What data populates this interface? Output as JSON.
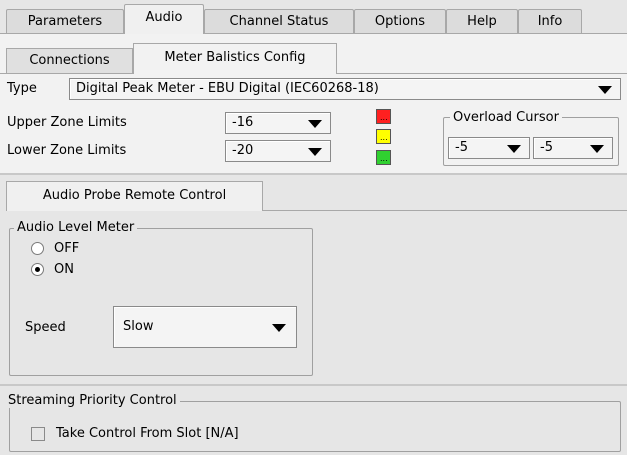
{
  "tabs": [
    {
      "label": "Parameters"
    },
    {
      "label": "Audio"
    },
    {
      "label": "Channel Status"
    },
    {
      "label": "Options"
    },
    {
      "label": "Help"
    },
    {
      "label": "Info"
    }
  ],
  "subtabs": [
    {
      "label": "Connections"
    },
    {
      "label": "Meter Balistics Config"
    }
  ],
  "type": {
    "label": "Type",
    "value": "Digital Peak Meter - EBU Digital (IEC60268-18)"
  },
  "upper_zone": {
    "label": "Upper Zone Limits",
    "value": "-16"
  },
  "lower_zone": {
    "label": "Lower Zone Limits",
    "value": "-20"
  },
  "leds": [
    {
      "color": "#ff2020",
      "text": "..."
    },
    {
      "color": "#ffff00",
      "text": "..."
    },
    {
      "color": "#30d030",
      "text": "..."
    }
  ],
  "overload_cursor": {
    "title": "Overload Cursor",
    "value1": "-5",
    "value2": "-5"
  },
  "probe_tab": {
    "label": "Audio Probe Remote Control"
  },
  "audio_level_meter": {
    "title": "Audio Level Meter",
    "options": [
      {
        "label": "OFF",
        "selected": false
      },
      {
        "label": "ON",
        "selected": true
      }
    ]
  },
  "speed": {
    "label": "Speed",
    "value": "Slow"
  },
  "streaming": {
    "title": "Streaming Priority Control",
    "checkbox_label": "Take Control From Slot [N/A]"
  }
}
